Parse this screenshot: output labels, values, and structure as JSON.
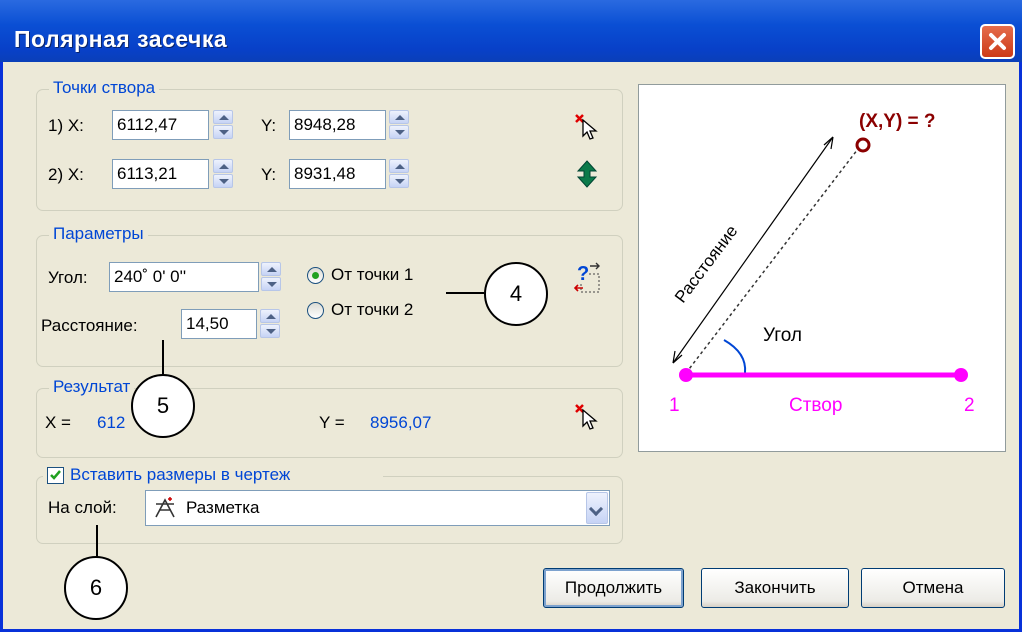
{
  "window": {
    "title": "Полярная засечка"
  },
  "points_group": {
    "legend": "Точки створа",
    "p1": {
      "label_x": "1) X:",
      "x": "6112,47",
      "label_y": "Y:",
      "y": "8948,28"
    },
    "p2": {
      "label_x": "2) X:",
      "x": "6113,21",
      "label_y": "Y:",
      "y": "8931,48"
    }
  },
  "params_group": {
    "legend": "Параметры",
    "angle_label": "Угол:",
    "angle_value": "240˚  0'  0''",
    "distance_label": "Расстояние:",
    "distance_value": "14,50",
    "radio_from1": "От точки 1",
    "radio_from2": "От точки 2",
    "selected_radio": "from1"
  },
  "result_group": {
    "legend": "Результат",
    "x_label": "X =",
    "x_value": "612",
    "y_label": "Y =",
    "y_value": "8956,07"
  },
  "insert_group": {
    "checkbox_label": "Вставить размеры в чертеж",
    "checked": true,
    "layer_label": "На слой:",
    "layer_value": "Разметка"
  },
  "buttons": {
    "continue": "Продолжить",
    "finish": "Закончить",
    "cancel": "Отмена"
  },
  "diagram": {
    "target_label": "(X,Y) = ?",
    "distance_label": "Расстояние",
    "angle_label": "Угол",
    "line_label": "Створ",
    "point1": "1",
    "point2": "2"
  },
  "callouts": {
    "c4": "4",
    "c5": "5",
    "c6": "6"
  },
  "colors": {
    "accent": "#0046d5",
    "magenta": "#ff00ff",
    "target": "#8b0000",
    "titlebar": "#0a4fd4"
  }
}
